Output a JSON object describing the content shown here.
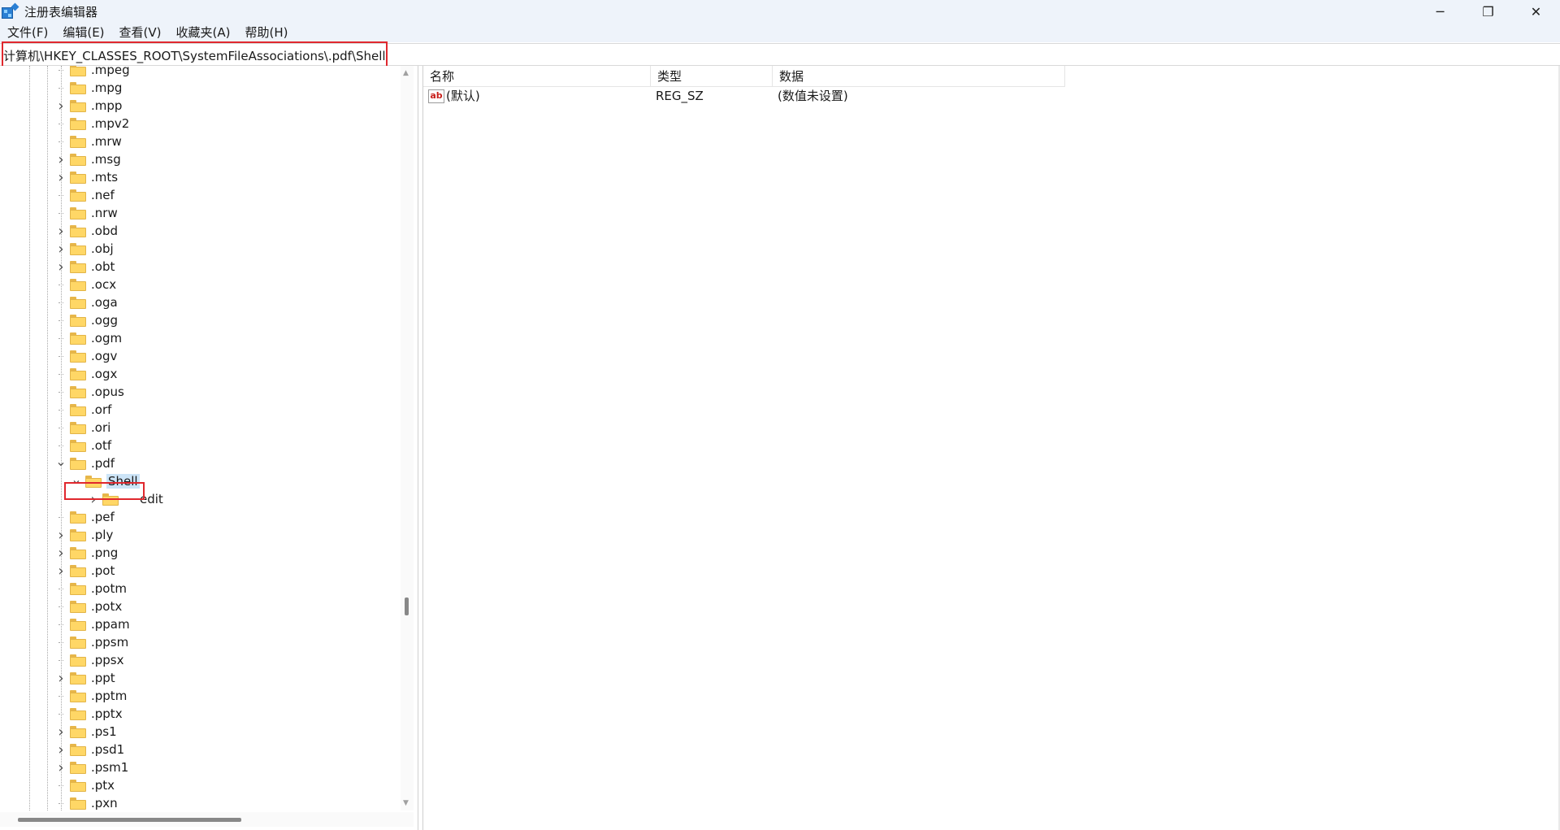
{
  "window": {
    "title": "注册表编辑器",
    "controls": {
      "minimize": "─",
      "restore": "❐",
      "close": "✕"
    }
  },
  "menu": [
    "文件(F)",
    "编辑(E)",
    "查看(V)",
    "收藏夹(A)",
    "帮助(H)"
  ],
  "address": {
    "path": "计算机\\HKEY_CLASSES_ROOT\\SystemFileAssociations\\.pdf\\Shell"
  },
  "tree": {
    "items": [
      {
        "label": ".mpeg",
        "expander": "",
        "level": 0
      },
      {
        "label": ".mpg",
        "expander": "",
        "level": 0
      },
      {
        "label": ".mpp",
        "expander": ">",
        "level": 0
      },
      {
        "label": ".mpv2",
        "expander": "",
        "level": 0
      },
      {
        "label": ".mrw",
        "expander": "",
        "level": 0
      },
      {
        "label": ".msg",
        "expander": ">",
        "level": 0
      },
      {
        "label": ".mts",
        "expander": ">",
        "level": 0
      },
      {
        "label": ".nef",
        "expander": "",
        "level": 0
      },
      {
        "label": ".nrw",
        "expander": "",
        "level": 0
      },
      {
        "label": ".obd",
        "expander": ">",
        "level": 0
      },
      {
        "label": ".obj",
        "expander": ">",
        "level": 0
      },
      {
        "label": ".obt",
        "expander": ">",
        "level": 0
      },
      {
        "label": ".ocx",
        "expander": "",
        "level": 0
      },
      {
        "label": ".oga",
        "expander": "",
        "level": 0
      },
      {
        "label": ".ogg",
        "expander": "",
        "level": 0
      },
      {
        "label": ".ogm",
        "expander": "",
        "level": 0
      },
      {
        "label": ".ogv",
        "expander": "",
        "level": 0
      },
      {
        "label": ".ogx",
        "expander": "",
        "level": 0
      },
      {
        "label": ".opus",
        "expander": "",
        "level": 0
      },
      {
        "label": ".orf",
        "expander": "",
        "level": 0
      },
      {
        "label": ".ori",
        "expander": "",
        "level": 0
      },
      {
        "label": ".otf",
        "expander": "",
        "level": 0
      },
      {
        "label": ".pdf",
        "expander": "v",
        "level": 0
      },
      {
        "label": "Shell",
        "expander": "v",
        "level": 1,
        "selected": true
      },
      {
        "label": "edit",
        "expander": ">",
        "level": 2
      },
      {
        "label": ".pef",
        "expander": "",
        "level": 0
      },
      {
        "label": ".ply",
        "expander": ">",
        "level": 0
      },
      {
        "label": ".png",
        "expander": ">",
        "level": 0
      },
      {
        "label": ".pot",
        "expander": ">",
        "level": 0
      },
      {
        "label": ".potm",
        "expander": "",
        "level": 0
      },
      {
        "label": ".potx",
        "expander": "",
        "level": 0
      },
      {
        "label": ".ppam",
        "expander": "",
        "level": 0
      },
      {
        "label": ".ppsm",
        "expander": "",
        "level": 0
      },
      {
        "label": ".ppsx",
        "expander": "",
        "level": 0
      },
      {
        "label": ".ppt",
        "expander": ">",
        "level": 0
      },
      {
        "label": ".pptm",
        "expander": "",
        "level": 0
      },
      {
        "label": ".pptx",
        "expander": "",
        "level": 0
      },
      {
        "label": ".ps1",
        "expander": ">",
        "level": 0
      },
      {
        "label": ".psd1",
        "expander": ">",
        "level": 0
      },
      {
        "label": ".psm1",
        "expander": ">",
        "level": 0
      },
      {
        "label": ".ptx",
        "expander": "",
        "level": 0
      },
      {
        "label": ".pxn",
        "expander": "",
        "level": 0
      }
    ]
  },
  "values": {
    "columns": [
      "名称",
      "类型",
      "数据"
    ],
    "rows": [
      {
        "icon": "ab",
        "name": "(默认)",
        "type": "REG_SZ",
        "data": "(数值未设置)"
      }
    ]
  },
  "colors": {
    "highlight_box": "#e0282e",
    "selection": "#cce4f7",
    "titlebar": "#eef3fa"
  }
}
